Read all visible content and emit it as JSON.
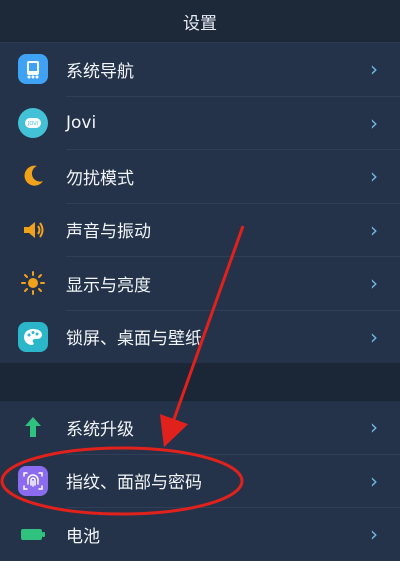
{
  "header": {
    "title": "设置"
  },
  "sections": [
    {
      "items": [
        {
          "label": "系统导航",
          "icon": "navigation-icon",
          "icon_color": "#3fa2f5"
        },
        {
          "label": "Jovi",
          "icon": "jovi-icon",
          "icon_color": "#43c1d6"
        },
        {
          "label": "勿扰模式",
          "icon": "moon-icon",
          "icon_color": "#f2a21a"
        },
        {
          "label": "声音与振动",
          "icon": "speaker-icon",
          "icon_color": "#f2a21a"
        },
        {
          "label": "显示与亮度",
          "icon": "sun-icon",
          "icon_color": "#f2a21a"
        },
        {
          "label": "锁屏、桌面与壁纸",
          "icon": "palette-icon",
          "icon_color": "#2bb7c9"
        }
      ]
    },
    {
      "items": [
        {
          "label": "系统升级",
          "icon": "arrow-up-icon",
          "icon_color": "#2ec27e"
        },
        {
          "label": "指纹、面部与密码",
          "icon": "fingerprint-icon",
          "icon_color": "#8b6cf0"
        },
        {
          "label": "电池",
          "icon": "battery-icon",
          "icon_color": "#2ec27e"
        }
      ]
    }
  ],
  "chevron_color": "#6fb6e6",
  "annotation_color": "#e0211c"
}
